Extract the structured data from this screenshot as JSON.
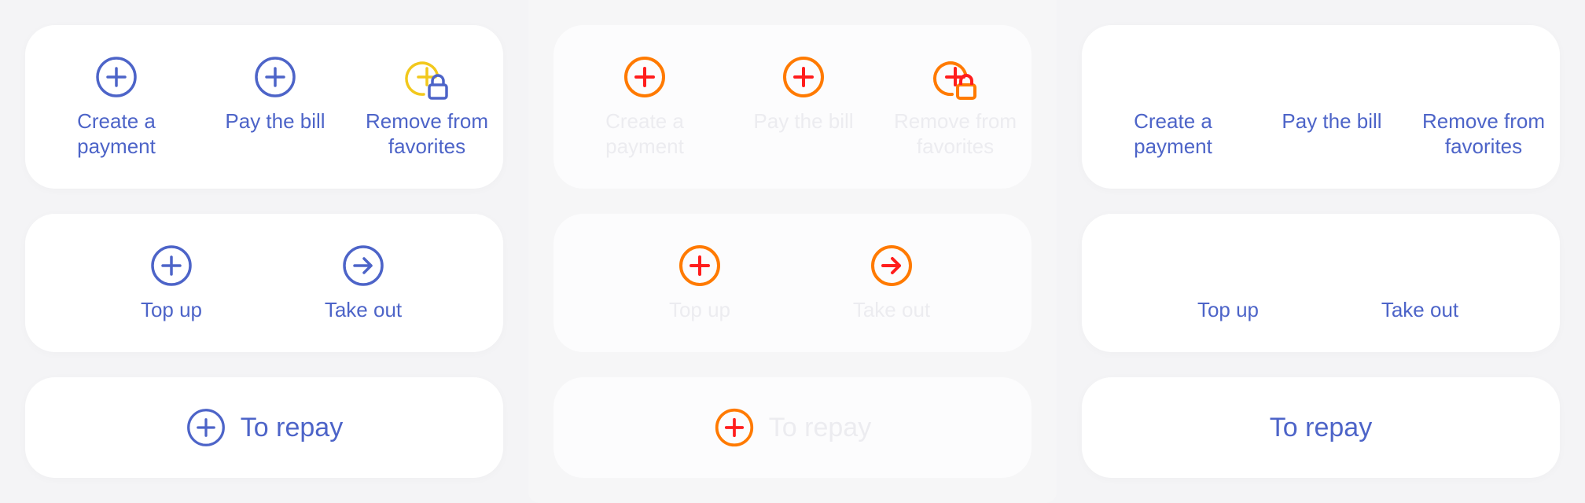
{
  "colors": {
    "primary": "#4d64c8",
    "warning": "#f2c81c",
    "accent_red": "#ff1d1d",
    "accent_orange": "#ff7a00",
    "faded_text": "#ececf0"
  },
  "variants": [
    {
      "id": "default",
      "actions_primary": [
        {
          "label": "Create a\npayment",
          "icon": "plus-circle-icon"
        },
        {
          "label": "Pay the bill",
          "icon": "plus-circle-icon"
        },
        {
          "label": "Remove from\nfavorites",
          "icon": "plus-circle-lock-icon"
        }
      ],
      "actions_secondary": [
        {
          "label": "Top up",
          "icon": "plus-circle-icon"
        },
        {
          "label": "Take out",
          "icon": "arrow-right-circle-icon"
        }
      ],
      "repay": {
        "label": "To repay",
        "icon": "plus-circle-icon"
      }
    },
    {
      "id": "icons-only",
      "actions_primary": [
        {
          "label": "Create a\npayment",
          "icon": "plus-circle-icon"
        },
        {
          "label": "Pay the bill",
          "icon": "plus-circle-icon"
        },
        {
          "label": "Remove from\nfavorites",
          "icon": "plus-circle-lock-icon"
        }
      ],
      "actions_secondary": [
        {
          "label": "Top up",
          "icon": "plus-circle-icon"
        },
        {
          "label": "Take out",
          "icon": "arrow-right-circle-icon"
        }
      ],
      "repay": {
        "label": "To repay",
        "icon": "plus-circle-icon"
      }
    },
    {
      "id": "labels-only",
      "actions_primary": [
        {
          "label": "Create a\npayment",
          "icon": "none"
        },
        {
          "label": "Pay the bill",
          "icon": "none"
        },
        {
          "label": "Remove from\nfavorites",
          "icon": "none"
        }
      ],
      "actions_secondary": [
        {
          "label": "Top up",
          "icon": "none"
        },
        {
          "label": "Take out",
          "icon": "none"
        }
      ],
      "repay": {
        "label": "To repay",
        "icon": "none"
      }
    }
  ]
}
